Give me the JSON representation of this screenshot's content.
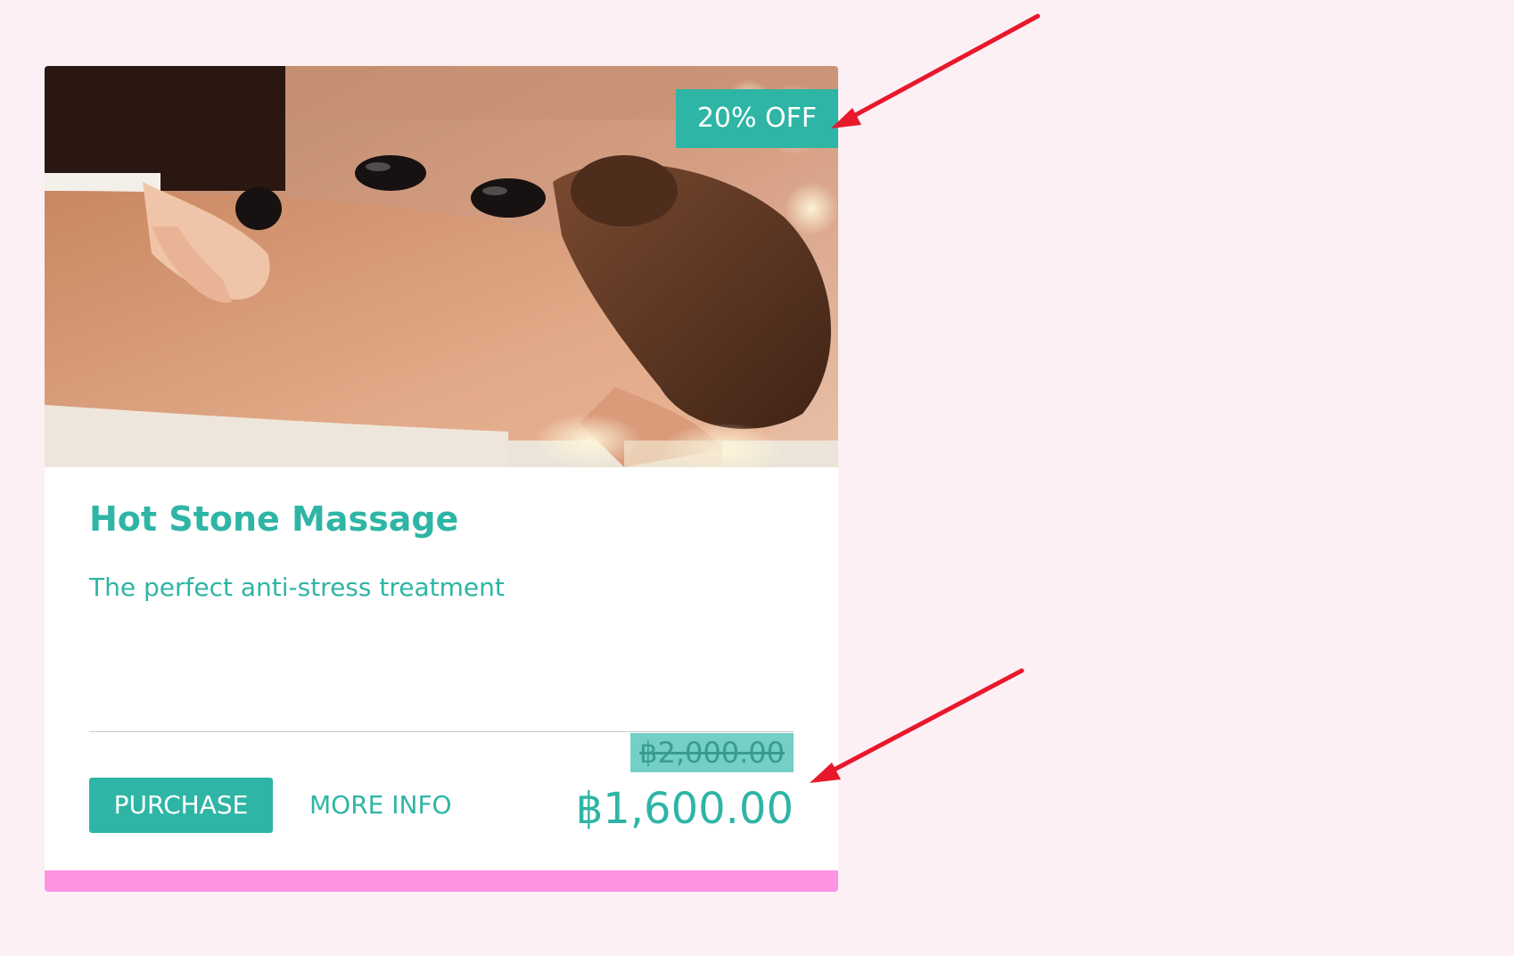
{
  "card": {
    "badge": "20% OFF",
    "title": "Hot Stone Massage",
    "subtitle": "The perfect anti-stress treatment",
    "purchase_label": "PURCHASE",
    "more_info_label": "MORE INFO",
    "old_price": "฿2,000.00",
    "new_price": "฿1,600.00",
    "image_alt": "spa-hot-stone-massage-photo"
  },
  "colors": {
    "accent": "#2eb5a5",
    "page_background": "#fcf0f4",
    "bottom_bar": "#fc94e2",
    "annotation_arrow": "#e8182c"
  }
}
